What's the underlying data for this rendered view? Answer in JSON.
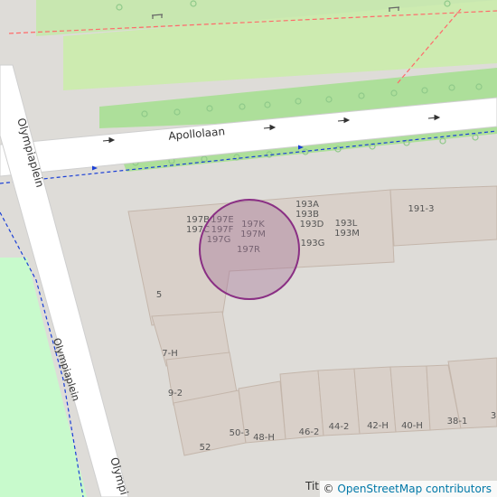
{
  "streets": {
    "apollolaan": "Apollolaan",
    "olympiaplein_upper": "Olympiaplein",
    "olympiaplein_path": "Olympiaplein",
    "olympiaplein_lower": "Olympi",
    "bottom_partial": "Tit"
  },
  "house_numbers": {
    "n197b": "197B",
    "n197e": "197E",
    "n197c": "197C",
    "n197f": "197F",
    "n197g": "197G",
    "n197k": "197K",
    "n197m": "197M",
    "n197r": "197R",
    "n193a": "193A",
    "n193b": "193B",
    "n193d": "193D",
    "n193g": "193G",
    "n193l": "193L",
    "n193m": "193M",
    "n191_3": "191-3",
    "n5": "5",
    "n7h": "7-H",
    "n9_2": "9-2",
    "n50_3": "50-3",
    "n48h": "48-H",
    "n46_2": "46-2",
    "n44_2": "44-2",
    "n42h": "42-H",
    "n40h": "40-H",
    "n38_1": "38-1",
    "n3": "3",
    "n52": "52"
  },
  "attribution": {
    "copyright_symbol": "©",
    "link_text": "OpenStreetMap contributors"
  },
  "colors": {
    "background": "#dedcd8",
    "road": "#ffffff",
    "park": "#c8facc",
    "grass": "#cdebb0",
    "building": "#d9d0c9",
    "building_outline": "#c4b6ab",
    "tram_line": "#ff6a6a",
    "cycleway": "#1a3fd6",
    "marker_fill": "#a7779c",
    "marker_stroke": "#8a2f84"
  }
}
